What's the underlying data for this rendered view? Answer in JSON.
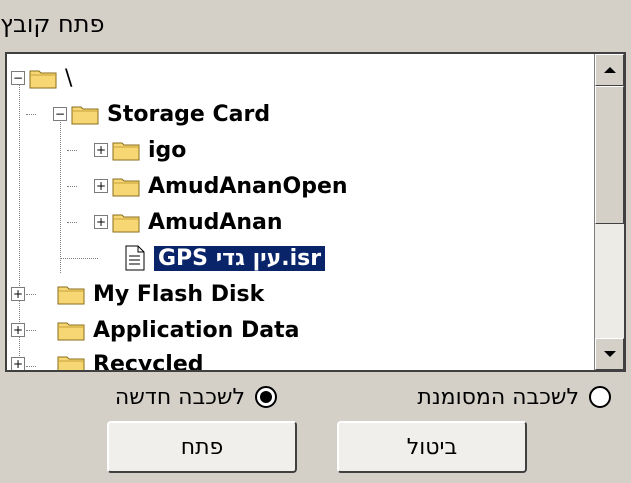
{
  "dialog": {
    "title": "פתח קובץ"
  },
  "tree": {
    "items": [
      {
        "label": "\\",
        "level": 0,
        "expanded": true,
        "type": "folder"
      },
      {
        "label": "Storage Card",
        "level": 1,
        "expanded": true,
        "type": "folder"
      },
      {
        "label": "igo",
        "level": 2,
        "expanded": false,
        "type": "folder"
      },
      {
        "label": "AmudAnanOpen",
        "level": 2,
        "expanded": false,
        "type": "folder"
      },
      {
        "label": "AmudAnan",
        "level": 2,
        "expanded": false,
        "type": "folder"
      },
      {
        "label": "GPS עין גדי.isr",
        "level": 2,
        "type": "file",
        "selected": true
      },
      {
        "label": "My Flash Disk",
        "level": 1,
        "expanded": false,
        "type": "folder"
      },
      {
        "label": "Application Data",
        "level": 1,
        "expanded": false,
        "type": "folder"
      },
      {
        "label": "Recycled",
        "level": 1,
        "expanded": false,
        "type": "folder"
      }
    ]
  },
  "options": {
    "new_layer": {
      "label": "לשכבה חדשה",
      "checked": true
    },
    "marked_layer": {
      "label": "לשכבה המסומנת",
      "checked": false
    }
  },
  "buttons": {
    "open": "פתח",
    "cancel": "ביטול"
  },
  "colors": {
    "selection": "#0a246a",
    "dialog_bg": "#d4d0c8",
    "folder": "#f7d774"
  }
}
